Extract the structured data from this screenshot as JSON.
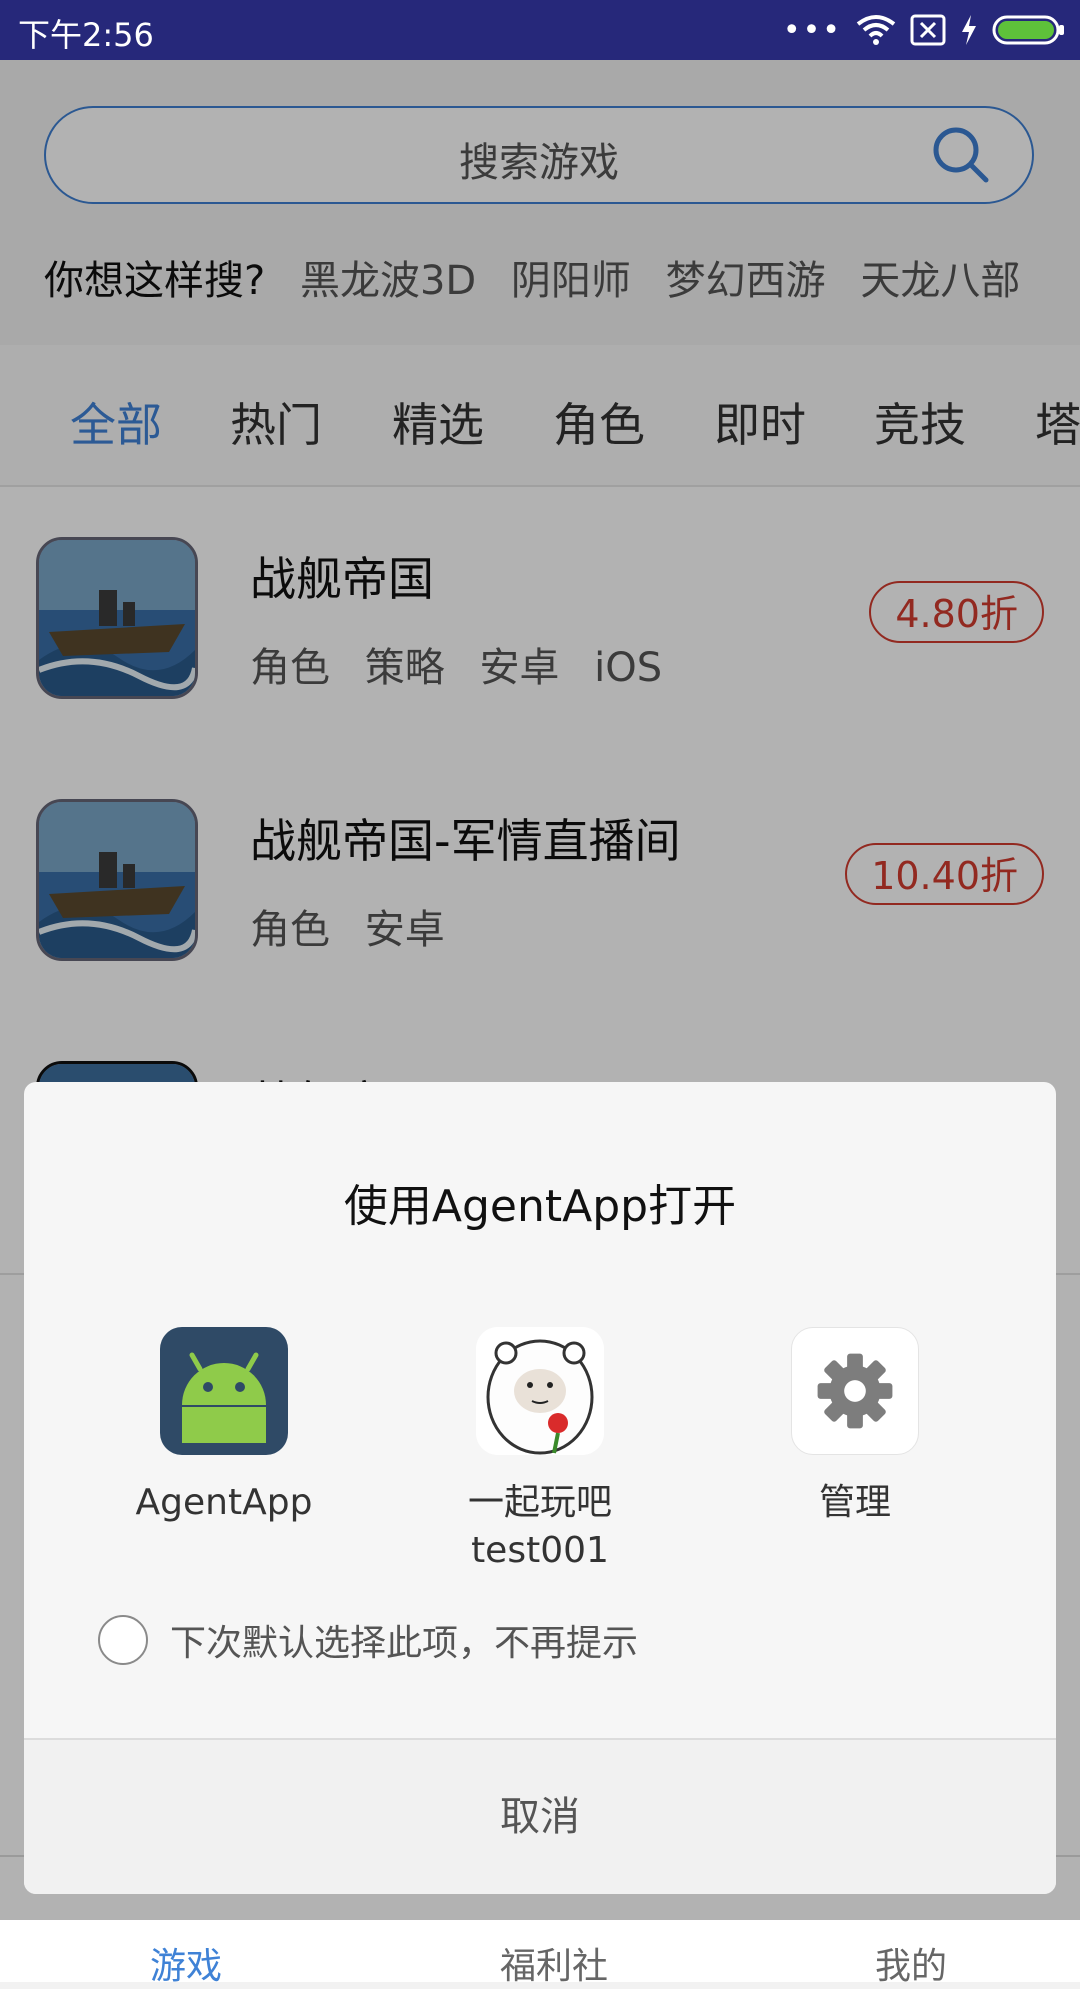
{
  "status_bar": {
    "time": "下午2:56",
    "battery_color": "#5ec13a"
  },
  "search": {
    "placeholder": "搜索游戏",
    "suggest_label": "你想这样搜?",
    "suggestions": [
      "黑龙波3D",
      "阴阳师",
      "梦幻西游",
      "天龙八部"
    ]
  },
  "tabs": [
    {
      "label": "全部",
      "active": true
    },
    {
      "label": "热门"
    },
    {
      "label": "精选"
    },
    {
      "label": "角色"
    },
    {
      "label": "即时"
    },
    {
      "label": "竞技"
    },
    {
      "label": "塔"
    }
  ],
  "games": [
    {
      "title": "战舰帝国",
      "tags": [
        "角色",
        "策略",
        "安卓",
        "iOS"
      ],
      "discount": "4.80折"
    },
    {
      "title": "战舰帝国-军情直播间",
      "tags": [
        "角色",
        "安卓"
      ],
      "discount": "10.40折"
    },
    {
      "title": "战舰帝国"
    }
  ],
  "bottom_nav": [
    "游戏",
    "福利社",
    "我的"
  ],
  "dialog": {
    "title": "使用AgentApp打开",
    "apps": [
      {
        "label": "AgentApp",
        "icon": "android-icon"
      },
      {
        "label": "一起玩吧\ntest001",
        "icon": "meme-face-icon"
      },
      {
        "label": "管理",
        "icon": "gear-icon"
      }
    ],
    "remember_label": "下次默认选择此项，不再提示",
    "cancel_label": "取消"
  },
  "colors": {
    "status_bar": "#26287a",
    "accent": "#3f82d6",
    "discount": "#d23b2f"
  }
}
